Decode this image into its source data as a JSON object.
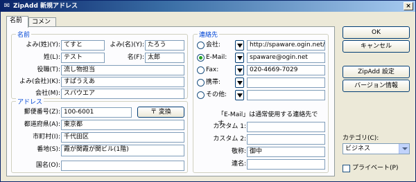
{
  "window": {
    "title": "ZipAdd 新規アドレス",
    "close": "×"
  },
  "tabs": [
    "名前",
    "コメント"
  ],
  "name_group": {
    "label": "名前",
    "yomi_sei_label": "よみ(姓)(Y):",
    "yomi_sei_value": "てすと",
    "yomi_mei_label": "よみ(名)(Y):",
    "yomi_mei_value": "たろう",
    "sei_label": "姓(L):",
    "sei_value": "テスト",
    "mei_label": "名(F):",
    "mei_value": "太郎",
    "yakushoku_label": "役職(T):",
    "yakushoku_value": "流し物担当",
    "yomi_kaisha_label": "よみ(会社)(K):",
    "yomi_kaisha_value": "すぱうえあ",
    "kaisha_label": "会社(M):",
    "kaisha_value": "スパウエア"
  },
  "address_group": {
    "label": "アドレス",
    "zip_label": "郵便番号(Z):",
    "zip_value": "100-6001",
    "convert_button": "〒 変換",
    "pref_label": "都道府県(A):",
    "pref_value": "東京都",
    "city_label": "市町村(I):",
    "city_value": "千代田区",
    "street_label": "番地(S):",
    "street_value": "霞が関霞が関ビル(1階)",
    "country_label": "国名(O):",
    "country_value": ""
  },
  "contact_group": {
    "label": "連絡先",
    "rows": [
      {
        "label": "会社:",
        "value": "http://spaware.ogin.net/",
        "checked": false
      },
      {
        "label": "E-Mail:",
        "value": "spaware@ogin.net",
        "checked": true
      },
      {
        "label": "Fax:",
        "value": "020-4669-7029",
        "checked": false
      },
      {
        "label": "携帯:",
        "value": "",
        "checked": false
      },
      {
        "label": "その他:",
        "value": "",
        "checked": false
      }
    ],
    "note": "「E-Mail」は通常使用する連絡先です。",
    "custom1_label": "カスタム 1:",
    "custom1_value": "",
    "custom2_label": "カスタム 2:",
    "custom2_value": "",
    "keisho_label": "敬称:",
    "keisho_value": "御中",
    "renmei_label": "連名:",
    "renmei_value": ""
  },
  "buttons": {
    "ok": "OK",
    "cancel": "キャンセル",
    "settings": "ZipAdd 設定",
    "version": "バージョン情報"
  },
  "category": {
    "label": "カテゴリ(C):",
    "value": "ビジネス"
  },
  "private": {
    "label": "プライベート(P)",
    "checked": false
  },
  "colors": {
    "title_bar": "#0a246a",
    "group_label": "#0046d5",
    "face": "#ece9d8"
  }
}
